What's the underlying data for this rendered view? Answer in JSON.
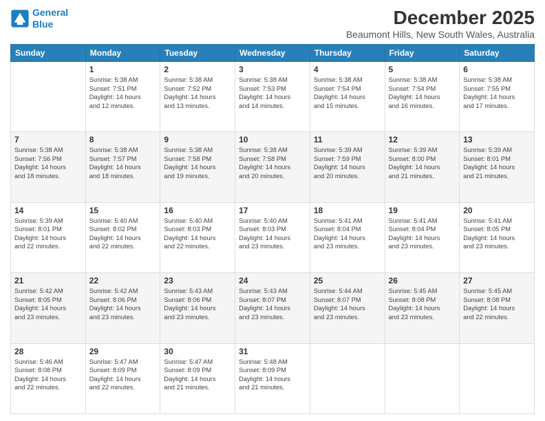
{
  "logo": {
    "line1": "General",
    "line2": "Blue"
  },
  "title": "December 2025",
  "subtitle": "Beaumont Hills, New South Wales, Australia",
  "days_header": [
    "Sunday",
    "Monday",
    "Tuesday",
    "Wednesday",
    "Thursday",
    "Friday",
    "Saturday"
  ],
  "weeks": [
    [
      {
        "day": "",
        "info": ""
      },
      {
        "day": "1",
        "info": "Sunrise: 5:38 AM\nSunset: 7:51 PM\nDaylight: 14 hours\nand 12 minutes."
      },
      {
        "day": "2",
        "info": "Sunrise: 5:38 AM\nSunset: 7:52 PM\nDaylight: 14 hours\nand 13 minutes."
      },
      {
        "day": "3",
        "info": "Sunrise: 5:38 AM\nSunset: 7:53 PM\nDaylight: 14 hours\nand 14 minutes."
      },
      {
        "day": "4",
        "info": "Sunrise: 5:38 AM\nSunset: 7:54 PM\nDaylight: 14 hours\nand 15 minutes."
      },
      {
        "day": "5",
        "info": "Sunrise: 5:38 AM\nSunset: 7:54 PM\nDaylight: 14 hours\nand 16 minutes."
      },
      {
        "day": "6",
        "info": "Sunrise: 5:38 AM\nSunset: 7:55 PM\nDaylight: 14 hours\nand 17 minutes."
      }
    ],
    [
      {
        "day": "7",
        "info": "Sunrise: 5:38 AM\nSunset: 7:56 PM\nDaylight: 14 hours\nand 18 minutes."
      },
      {
        "day": "8",
        "info": "Sunrise: 5:38 AM\nSunset: 7:57 PM\nDaylight: 14 hours\nand 18 minutes."
      },
      {
        "day": "9",
        "info": "Sunrise: 5:38 AM\nSunset: 7:58 PM\nDaylight: 14 hours\nand 19 minutes."
      },
      {
        "day": "10",
        "info": "Sunrise: 5:38 AM\nSunset: 7:58 PM\nDaylight: 14 hours\nand 20 minutes."
      },
      {
        "day": "11",
        "info": "Sunrise: 5:39 AM\nSunset: 7:59 PM\nDaylight: 14 hours\nand 20 minutes."
      },
      {
        "day": "12",
        "info": "Sunrise: 5:39 AM\nSunset: 8:00 PM\nDaylight: 14 hours\nand 21 minutes."
      },
      {
        "day": "13",
        "info": "Sunrise: 5:39 AM\nSunset: 8:01 PM\nDaylight: 14 hours\nand 21 minutes."
      }
    ],
    [
      {
        "day": "14",
        "info": "Sunrise: 5:39 AM\nSunset: 8:01 PM\nDaylight: 14 hours\nand 22 minutes."
      },
      {
        "day": "15",
        "info": "Sunrise: 5:40 AM\nSunset: 8:02 PM\nDaylight: 14 hours\nand 22 minutes."
      },
      {
        "day": "16",
        "info": "Sunrise: 5:40 AM\nSunset: 8:03 PM\nDaylight: 14 hours\nand 22 minutes."
      },
      {
        "day": "17",
        "info": "Sunrise: 5:40 AM\nSunset: 8:03 PM\nDaylight: 14 hours\nand 23 minutes."
      },
      {
        "day": "18",
        "info": "Sunrise: 5:41 AM\nSunset: 8:04 PM\nDaylight: 14 hours\nand 23 minutes."
      },
      {
        "day": "19",
        "info": "Sunrise: 5:41 AM\nSunset: 8:04 PM\nDaylight: 14 hours\nand 23 minutes."
      },
      {
        "day": "20",
        "info": "Sunrise: 5:41 AM\nSunset: 8:05 PM\nDaylight: 14 hours\nand 23 minutes."
      }
    ],
    [
      {
        "day": "21",
        "info": "Sunrise: 5:42 AM\nSunset: 8:05 PM\nDaylight: 14 hours\nand 23 minutes."
      },
      {
        "day": "22",
        "info": "Sunrise: 5:42 AM\nSunset: 8:06 PM\nDaylight: 14 hours\nand 23 minutes."
      },
      {
        "day": "23",
        "info": "Sunrise: 5:43 AM\nSunset: 8:06 PM\nDaylight: 14 hours\nand 23 minutes."
      },
      {
        "day": "24",
        "info": "Sunrise: 5:43 AM\nSunset: 8:07 PM\nDaylight: 14 hours\nand 23 minutes."
      },
      {
        "day": "25",
        "info": "Sunrise: 5:44 AM\nSunset: 8:07 PM\nDaylight: 14 hours\nand 23 minutes."
      },
      {
        "day": "26",
        "info": "Sunrise: 5:45 AM\nSunset: 8:08 PM\nDaylight: 14 hours\nand 23 minutes."
      },
      {
        "day": "27",
        "info": "Sunrise: 5:45 AM\nSunset: 8:08 PM\nDaylight: 14 hours\nand 22 minutes."
      }
    ],
    [
      {
        "day": "28",
        "info": "Sunrise: 5:46 AM\nSunset: 8:08 PM\nDaylight: 14 hours\nand 22 minutes."
      },
      {
        "day": "29",
        "info": "Sunrise: 5:47 AM\nSunset: 8:09 PM\nDaylight: 14 hours\nand 22 minutes."
      },
      {
        "day": "30",
        "info": "Sunrise: 5:47 AM\nSunset: 8:09 PM\nDaylight: 14 hours\nand 21 minutes."
      },
      {
        "day": "31",
        "info": "Sunrise: 5:48 AM\nSunset: 8:09 PM\nDaylight: 14 hours\nand 21 minutes."
      },
      {
        "day": "",
        "info": ""
      },
      {
        "day": "",
        "info": ""
      },
      {
        "day": "",
        "info": ""
      }
    ]
  ]
}
